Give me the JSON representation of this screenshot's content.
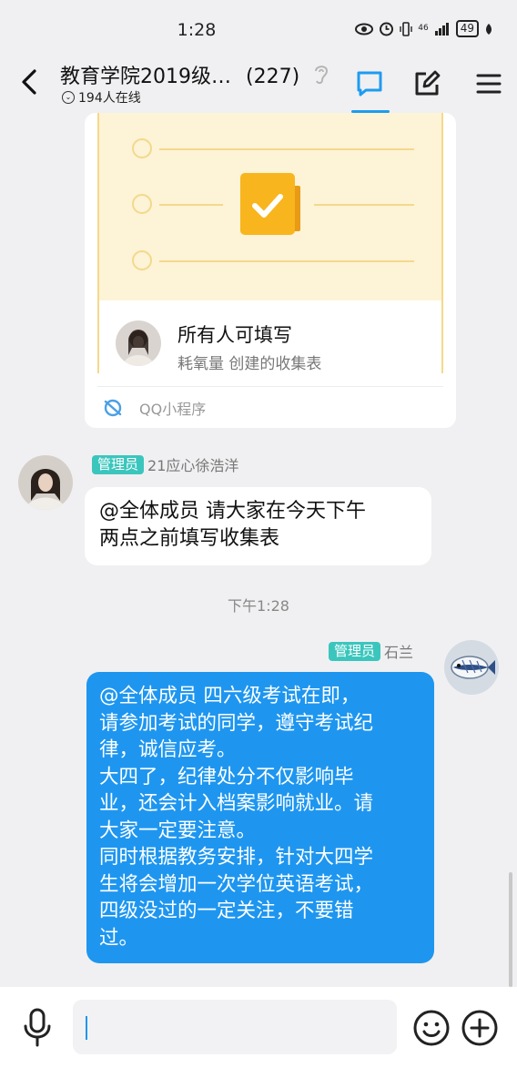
{
  "status_bar": {
    "time": "1:28",
    "signal": "46",
    "battery": "49"
  },
  "header": {
    "title": "教育学院2019级…",
    "member_count": "(227)",
    "online": "194人在线",
    "accent": "#1e9bf0"
  },
  "mini_program": {
    "form_title": "所有人可填写",
    "form_subtitle": "耗氧量 创建的收集表",
    "source": "QQ小程序"
  },
  "messages": [
    {
      "role_badge": "管理员",
      "sender": "21应心徐浩洋",
      "lines": [
        "@全体成员 请大家在今天下午",
        "两点之前填写收集表"
      ]
    },
    {
      "role_badge": "管理员",
      "sender": "石兰",
      "lines": [
        "@全体成员 四六级考试在即，",
        "请参加考试的同学，遵守考试纪",
        "律，诚信应考。",
        "大四了，纪律处分不仅影响毕",
        "业，还会计入档案影响就业。请",
        "大家一定要注意。",
        "同时根据教务安排，针对大四学",
        "生将会增加一次学位英语考试，",
        "四级没过的一定关注，不要错",
        "过。"
      ]
    }
  ],
  "time_separator": "下午1:28",
  "colors": {
    "badge": "#3bc6bd",
    "bubble_self": "#1e96f0",
    "background": "#f0f0f2"
  },
  "input": {
    "value": ""
  }
}
